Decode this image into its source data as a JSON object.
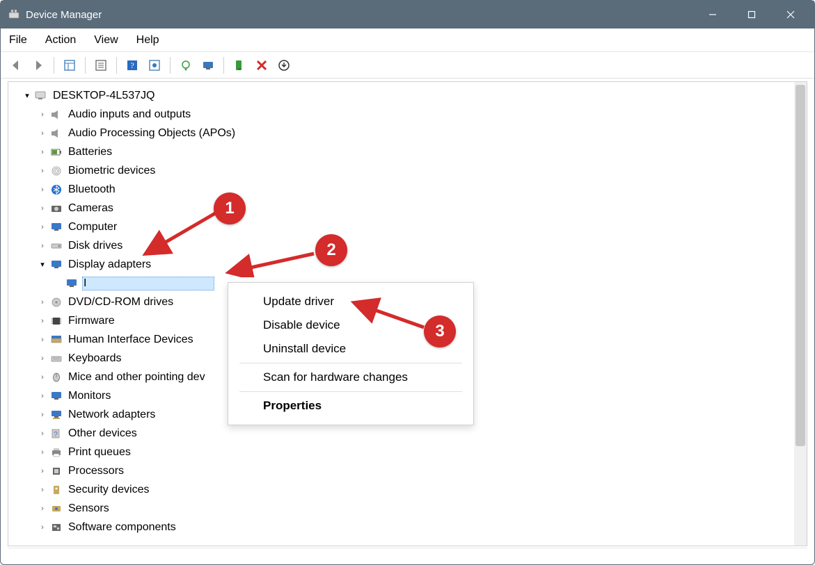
{
  "window": {
    "title": "Device Manager"
  },
  "menubar": {
    "file": "File",
    "action": "Action",
    "view": "View",
    "help": "Help"
  },
  "tree": {
    "root": "DESKTOP-4L537JQ",
    "categories": [
      {
        "label": "Audio inputs and outputs"
      },
      {
        "label": "Audio Processing Objects (APOs)"
      },
      {
        "label": "Batteries"
      },
      {
        "label": "Biometric devices"
      },
      {
        "label": "Bluetooth"
      },
      {
        "label": "Cameras"
      },
      {
        "label": "Computer"
      },
      {
        "label": "Disk drives"
      },
      {
        "label": "Display adapters",
        "expanded": true
      },
      {
        "label": "DVD/CD-ROM drives"
      },
      {
        "label": "Firmware"
      },
      {
        "label": "Human Interface Devices"
      },
      {
        "label": "Keyboards"
      },
      {
        "label": "Mice and other pointing dev"
      },
      {
        "label": "Monitors"
      },
      {
        "label": "Network adapters"
      },
      {
        "label": "Other devices"
      },
      {
        "label": "Print queues"
      },
      {
        "label": "Processors"
      },
      {
        "label": "Security devices"
      },
      {
        "label": "Sensors"
      },
      {
        "label": "Software components"
      }
    ],
    "selected_adapter": "I"
  },
  "context_menu": {
    "update": "Update driver",
    "disable": "Disable device",
    "uninstall": "Uninstall device",
    "scan": "Scan for hardware changes",
    "properties": "Properties"
  },
  "annotations": {
    "b1": "1",
    "b2": "2",
    "b3": "3"
  }
}
